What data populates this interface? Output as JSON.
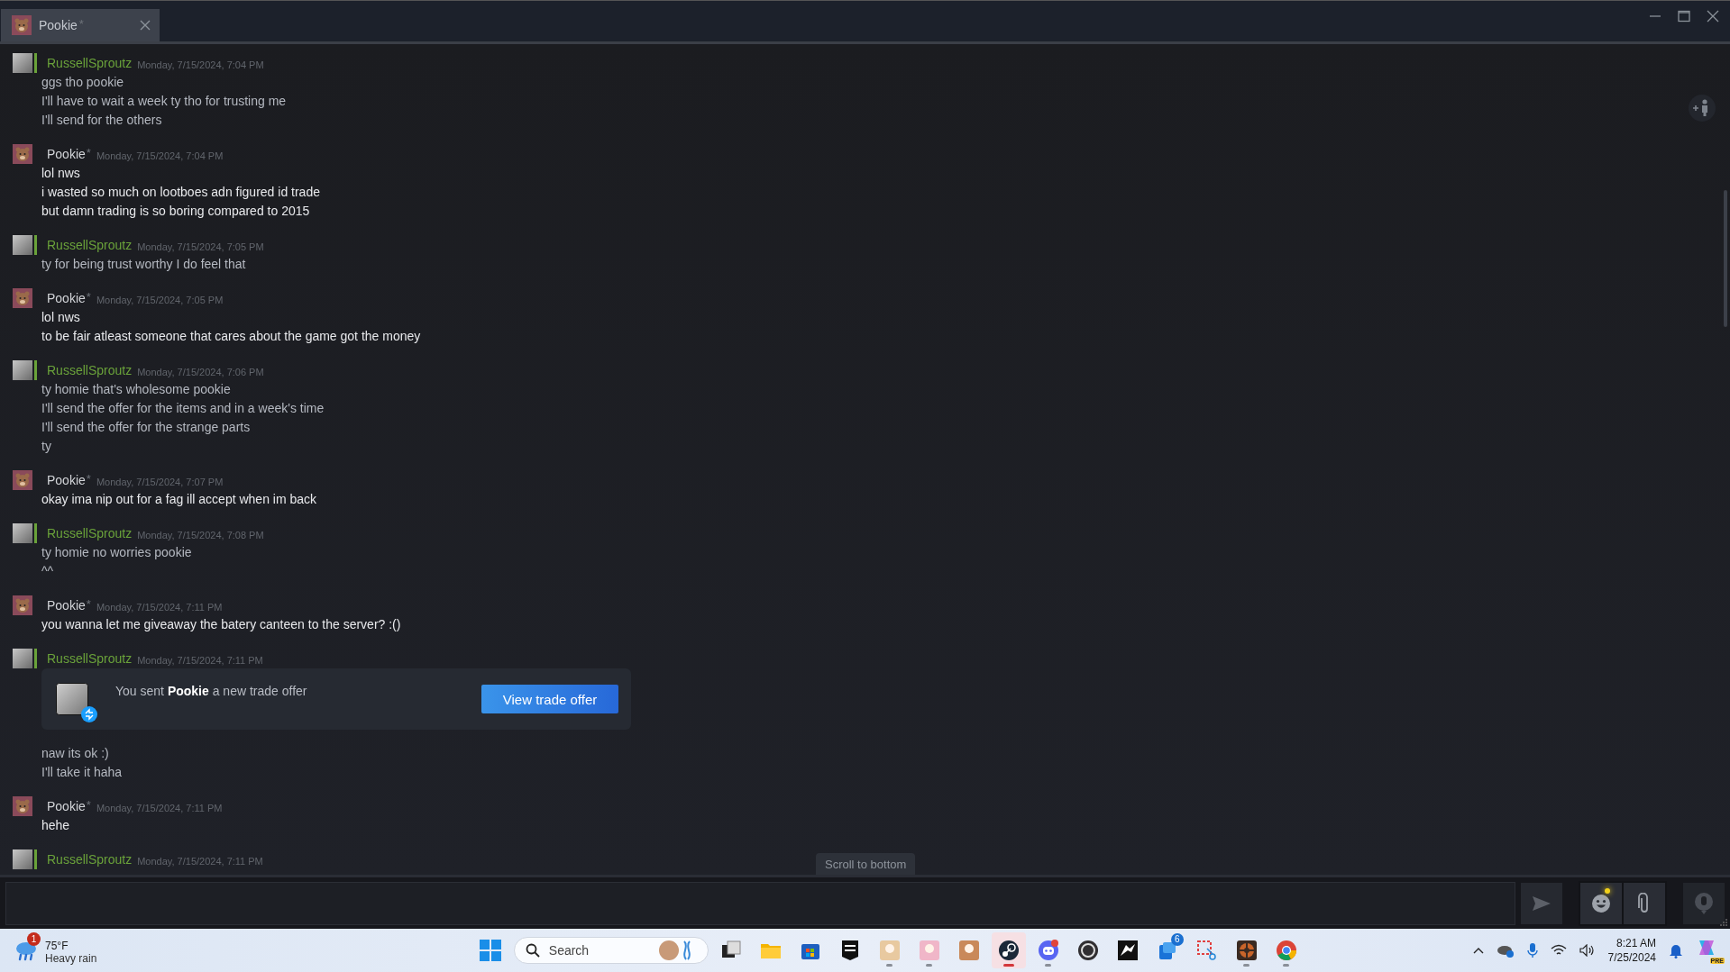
{
  "window": {
    "tab": {
      "title": "Pookie",
      "nickname_mark": "*",
      "selected": true
    }
  },
  "messages": [
    {
      "author": "RussellSproutz",
      "kind": "self",
      "time": "Monday, 7/15/2024, 7:04 PM",
      "lines": [
        "ggs tho pookie",
        "I'll have to wait a week ty tho for trusting me",
        "I'll send for the others"
      ]
    },
    {
      "author": "Pookie",
      "kind": "friend",
      "nickname_mark": "*",
      "time": "Monday, 7/15/2024, 7:04 PM",
      "lines": [
        "lol nws",
        "i wasted so much on lootboes adn figured id trade",
        "but damn trading is so boring compared to 2015"
      ]
    },
    {
      "author": "RussellSproutz",
      "kind": "self",
      "time": "Monday, 7/15/2024, 7:05 PM",
      "lines": [
        "ty for being trust worthy I do feel that"
      ]
    },
    {
      "author": "Pookie",
      "kind": "friend",
      "nickname_mark": "*",
      "time": "Monday, 7/15/2024, 7:05 PM",
      "lines": [
        "lol nws",
        "to be fair atleast someone that cares about the game got the money"
      ]
    },
    {
      "author": "RussellSproutz",
      "kind": "self",
      "time": "Monday, 7/15/2024, 7:06 PM",
      "lines": [
        "ty homie that's wholesome pookie",
        "I'll send the offer for the items and in a week's time",
        "I'll send the offer for the strange parts",
        "ty"
      ]
    },
    {
      "author": "Pookie",
      "kind": "friend",
      "nickname_mark": "*",
      "time": "Monday, 7/15/2024, 7:07 PM",
      "lines": [
        "okay ima nip out for a fag ill accept when im back"
      ]
    },
    {
      "author": "RussellSproutz",
      "kind": "self",
      "time": "Monday, 7/15/2024, 7:08 PM",
      "lines": [
        "ty homie no worries pookie",
        "^^"
      ]
    },
    {
      "author": "Pookie",
      "kind": "friend",
      "nickname_mark": "*",
      "time": "Monday, 7/15/2024, 7:11 PM",
      "lines": [
        "you wanna let me giveaway the batery canteen to the server? :()"
      ]
    },
    {
      "author": "RussellSproutz",
      "kind": "self",
      "time": "Monday, 7/15/2024, 7:11 PM",
      "trade_offer": {
        "text": "You sent **Pookie** a new trade offer",
        "button": "View trade offer"
      },
      "lines": [
        "naw its ok :)",
        "I'll take it haha"
      ]
    },
    {
      "author": "Pookie",
      "kind": "friend",
      "nickname_mark": "*",
      "time": "Monday, 7/15/2024, 7:11 PM",
      "lines": [
        "hehe"
      ]
    },
    {
      "author": "RussellSproutz",
      "kind": "self",
      "time": "Monday, 7/15/2024, 7:11 PM"
    }
  ],
  "scroll_to_bottom": "Scroll to bottom",
  "composer": {
    "emoji_new": true,
    "voice_disabled": true
  },
  "taskbar": {
    "weather": {
      "temp": "75°F",
      "condition": "Heavy rain",
      "badge": "1"
    },
    "search": {
      "placeholder": "Search"
    },
    "apps": [
      {
        "kind": "taskview",
        "running": false,
        "selected": false
      },
      {
        "kind": "folder",
        "running": false,
        "selected": false
      },
      {
        "kind": "store",
        "running": false,
        "selected": false
      },
      {
        "kind": "epic",
        "running": false,
        "selected": false
      },
      {
        "kind": "game",
        "running": true,
        "selected": false,
        "color": "#e8c9a0"
      },
      {
        "kind": "game",
        "running": true,
        "selected": false,
        "color": "#f0b6c8"
      },
      {
        "kind": "game",
        "running": false,
        "selected": false,
        "color": "#c9895a"
      },
      {
        "kind": "steam",
        "running": true,
        "selected": true
      },
      {
        "kind": "discord",
        "running": true,
        "selected": false
      },
      {
        "kind": "obs",
        "running": false,
        "selected": false
      },
      {
        "kind": "wolf",
        "running": false,
        "selected": false
      },
      {
        "kind": "phone",
        "running": false,
        "selected": false,
        "badge": "6"
      },
      {
        "kind": "snip",
        "running": false,
        "selected": false
      },
      {
        "kind": "tf",
        "running": true,
        "selected": false
      },
      {
        "kind": "chrome",
        "running": true,
        "selected": false
      }
    ],
    "time": "8:21 AM",
    "date": "7/25/2024",
    "copilot_badge": "PRE"
  }
}
